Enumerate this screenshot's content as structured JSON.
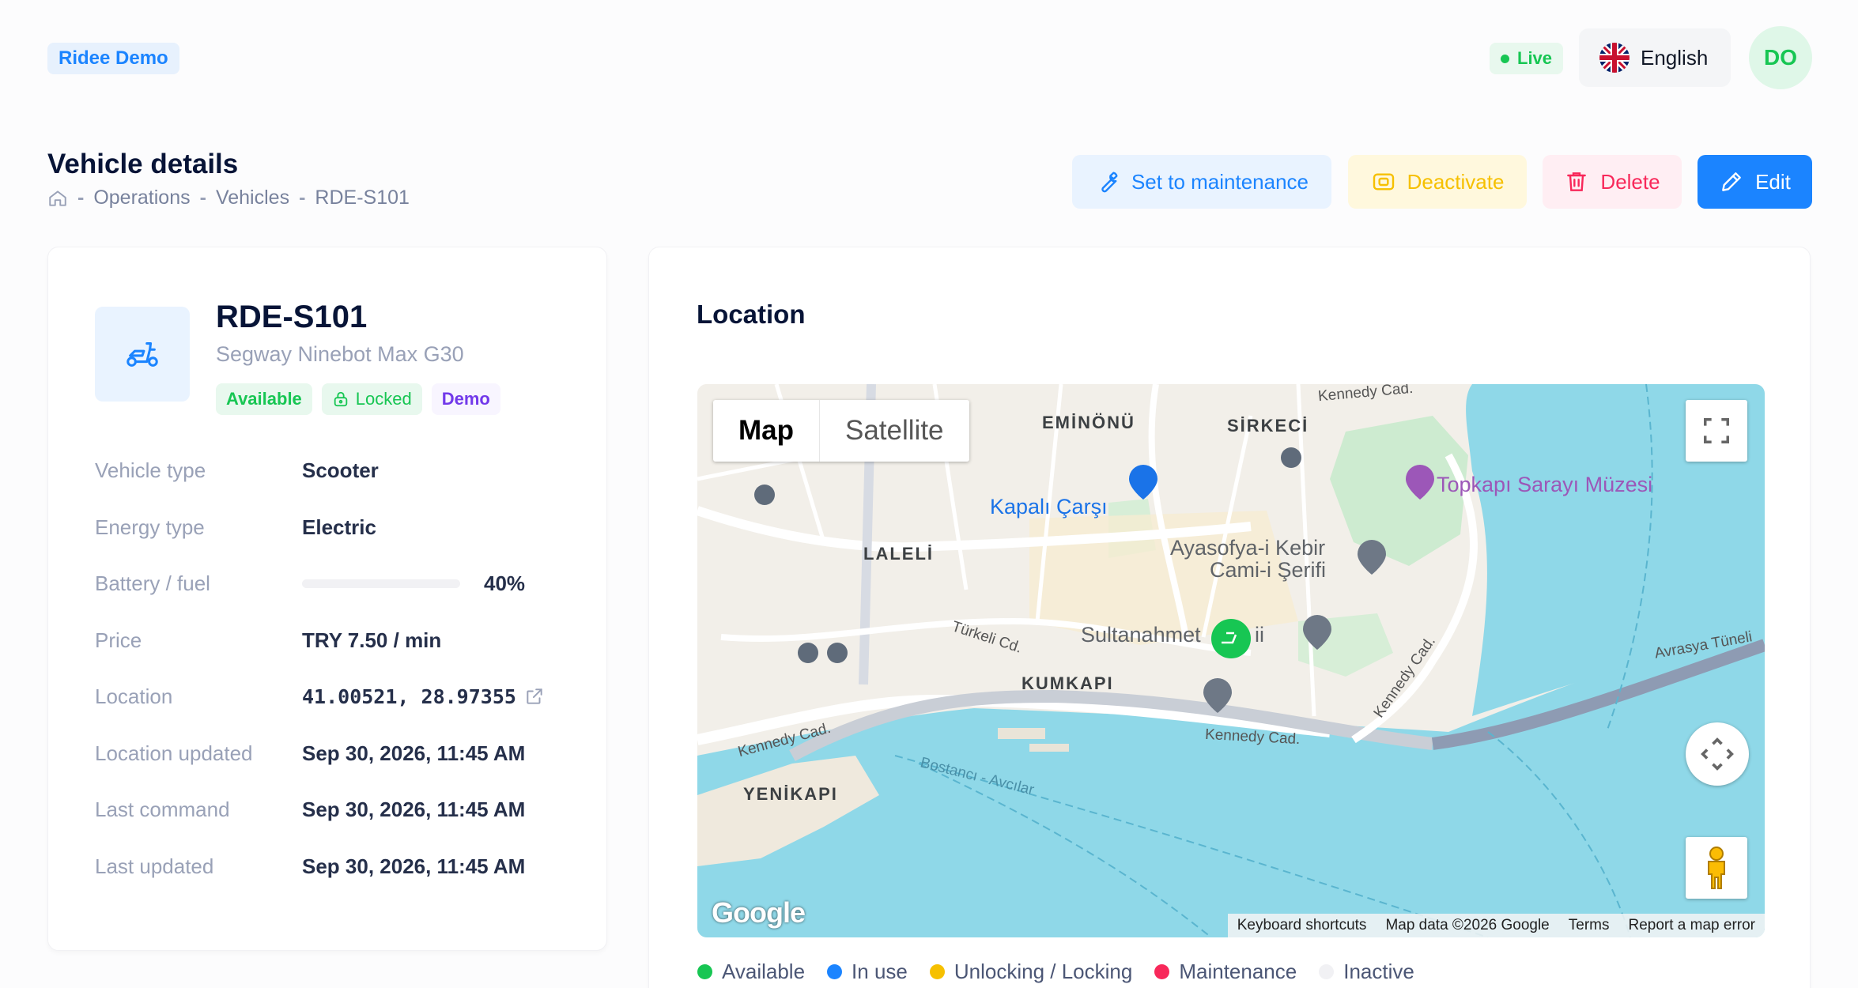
{
  "header": {
    "brand": "Ridee Demo",
    "live_label": "Live",
    "language": "English",
    "avatar_initials": "DO"
  },
  "page": {
    "title": "Vehicle details",
    "breadcrumb": [
      "Operations",
      "Vehicles",
      "RDE-S101"
    ],
    "breadcrumb_sep": "-"
  },
  "actions": {
    "maintenance": "Set to maintenance",
    "deactivate": "Deactivate",
    "delete": "Delete",
    "edit": "Edit"
  },
  "vehicle": {
    "code": "RDE-S101",
    "model": "Segway Ninebot Max G30",
    "badges": {
      "available": "Available",
      "locked": "Locked",
      "demo": "Demo"
    },
    "details": {
      "vehicle_type_label": "Vehicle type",
      "vehicle_type": "Scooter",
      "energy_type_label": "Energy type",
      "energy_type": "Electric",
      "battery_label": "Battery / fuel",
      "battery_text": "40%",
      "battery_level": 40,
      "price_label": "Price",
      "price": "TRY 7.50 / min",
      "location_label": "Location",
      "location": "41.00521, 28.97355",
      "location_updated_label": "Location updated",
      "location_updated": "Sep 30, 2026, 11:45 AM",
      "last_command_label": "Last command",
      "last_command": "Sep 30, 2026, 11:45 AM",
      "last_updated_label": "Last updated",
      "last_updated": "Sep 30, 2026, 11:45 AM"
    }
  },
  "location": {
    "title": "Location",
    "map": {
      "type_map": "Map",
      "type_satellite": "Satellite",
      "logo": "Google",
      "footer": {
        "shortcuts": "Keyboard shortcuts",
        "data": "Map data ©2026 Google",
        "terms": "Terms",
        "report": "Report a map error"
      },
      "labels": {
        "eminonu": "EMİNÖNÜ",
        "sirkeci": "SİRKECİ",
        "laleli": "LALELİ",
        "kumkapi": "KUMKAPI",
        "yenikapi": "YENİKAPI",
        "kapali_carsi": "Kapalı Çarşı",
        "topkapi": "Topkapı Sarayı Müzesi",
        "ayasofya_1": "Ayasofya-i Kebir",
        "ayasofya_2": "Cami-i Şerifi",
        "sultanahmet": "Sultanahmet",
        "sultanahmet_tail": "ii",
        "kennedy_1": "Kennedy Cad.",
        "kennedy_2": "Kennedy Cad.",
        "kennedy_3": "Kennedy Cad.",
        "kennedy_4": "Kennedy Cad.",
        "turkeli": "Türkeli Cd.",
        "avrasya": "Avrasya Tüneli",
        "bostanci": "Bostancı - Avcılar"
      }
    },
    "legend": [
      {
        "label": "Available",
        "color": "#17c653"
      },
      {
        "label": "In use",
        "color": "#1b84ff"
      },
      {
        "label": "Unlocking / Locking",
        "color": "#f6c000"
      },
      {
        "label": "Maintenance",
        "color": "#f8285a"
      },
      {
        "label": "Inactive",
        "color": "#f1f1f4"
      }
    ]
  }
}
